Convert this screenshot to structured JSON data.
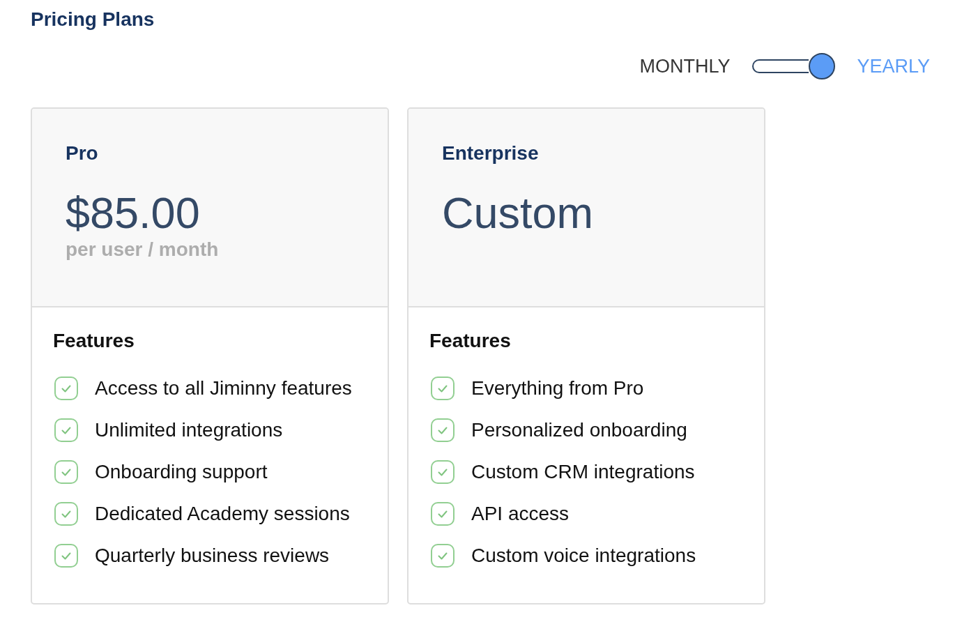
{
  "title": "Pricing Plans",
  "billing_toggle": {
    "left_label": "MONTHLY",
    "right_label": "YEARLY",
    "on": true
  },
  "plans": [
    {
      "name": "Pro",
      "price": "$85.00",
      "period": "per user / month",
      "features_heading": "Features",
      "features": [
        "Access to all Jiminny features",
        "Unlimited integrations",
        "Onboarding support",
        "Dedicated Academy sessions",
        "Quarterly business reviews"
      ]
    },
    {
      "name": "Enterprise",
      "price": "Custom",
      "features_heading": "Features",
      "features": [
        "Everything from Pro",
        "Personalized onboarding",
        "Custom CRM integrations",
        "API access",
        "Custom voice integrations"
      ]
    }
  ]
}
